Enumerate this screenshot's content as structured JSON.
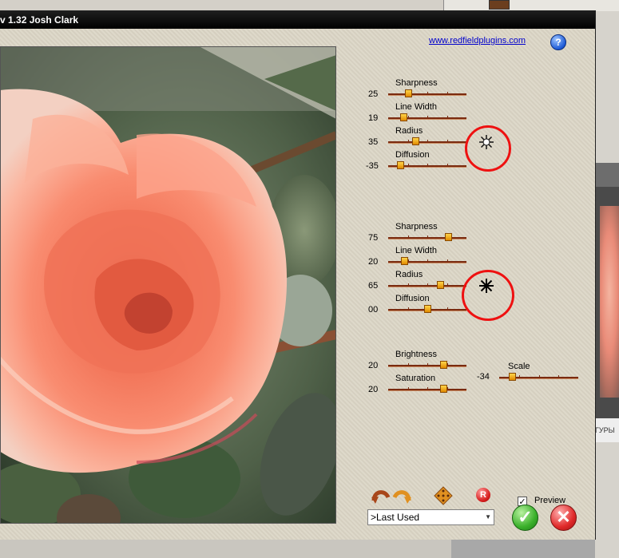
{
  "window": {
    "title": "v 1.32   Josh Clark",
    "link_text": "www.redfieldplugins.com",
    "help_label": "?"
  },
  "group1": {
    "sliders": [
      {
        "label": "Sharpness",
        "value": "25",
        "fraction": 0.26
      },
      {
        "label": "Line Width",
        "value": "19",
        "fraction": 0.19
      },
      {
        "label": "Radius",
        "value": "35",
        "fraction": 0.35
      },
      {
        "label": "Diffusion",
        "value": "-35",
        "fraction": 0.15
      }
    ],
    "light_icon": "sun-light-icon"
  },
  "group2": {
    "sliders": [
      {
        "label": "Sharpness",
        "value": "75",
        "fraction": 0.77
      },
      {
        "label": "Line Width",
        "value": "20",
        "fraction": 0.2
      },
      {
        "label": "Radius",
        "value": "65",
        "fraction": 0.66
      },
      {
        "label": "Diffusion",
        "value": "00",
        "fraction": 0.5
      }
    ],
    "light_icon": "dark-star-light-icon"
  },
  "group3": {
    "sliders": [
      {
        "label": "Brightness",
        "value": "20",
        "fraction": 0.7
      },
      {
        "label": "Saturation",
        "value": "20",
        "fraction": 0.7
      }
    ],
    "scale": {
      "label": "Scale",
      "value": "-34",
      "fraction": 0.16
    }
  },
  "toolbar": {
    "undo_redo_icon": "undo-redo-arrows-icon",
    "randomize_icon": "randomize-dice-icon",
    "reset_label": "R",
    "preview_label": "Preview",
    "preview_checked": true,
    "check_mark": "✓"
  },
  "preset": {
    "selected": ">Last Used"
  },
  "actions": {
    "ok_symbol": "✓",
    "cancel_symbol": "✕"
  },
  "background_app": {
    "tab_text": "ГУРЫ"
  }
}
